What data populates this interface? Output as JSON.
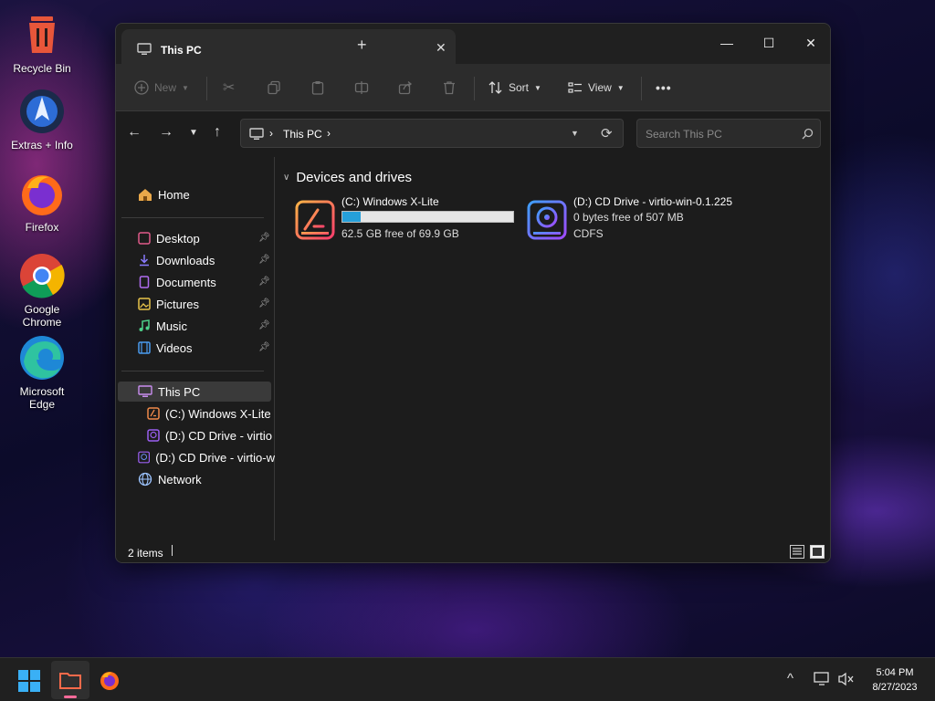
{
  "desktop": {
    "icons": [
      {
        "label": "Recycle Bin",
        "icon": "recycle-bin-icon"
      },
      {
        "label": "Extras + Info",
        "icon": "extras-info-icon"
      },
      {
        "label": "Firefox",
        "icon": "firefox-icon"
      },
      {
        "label": "Google Chrome",
        "icon": "chrome-icon"
      },
      {
        "label": "Microsoft Edge",
        "icon": "edge-icon"
      }
    ]
  },
  "window": {
    "tab_title": "This PC",
    "tab_close": "✕",
    "new_tab": "+",
    "controls": {
      "minimize": "—",
      "maximize": "☐",
      "close": "✕"
    }
  },
  "toolbar": {
    "new_label": "New",
    "sort_label": "Sort",
    "view_label": "View",
    "more_label": "•••"
  },
  "address": {
    "path": "This PC",
    "search_placeholder": "Search This PC"
  },
  "sidebar": {
    "home": "Home",
    "quick": [
      {
        "label": "Desktop",
        "icon": "desktop-icon",
        "color": "#e05a8a"
      },
      {
        "label": "Downloads",
        "icon": "downloads-icon",
        "color": "#8a7bff"
      },
      {
        "label": "Documents",
        "icon": "documents-icon",
        "color": "#b06cf0"
      },
      {
        "label": "Pictures",
        "icon": "pictures-icon",
        "color": "#e8c34a"
      },
      {
        "label": "Music",
        "icon": "music-icon",
        "color": "#4dd08a"
      },
      {
        "label": "Videos",
        "icon": "videos-icon",
        "color": "#4a9cf0"
      }
    ],
    "this_pc": "This PC",
    "c_drive": "(C:) Windows X-Lite",
    "d_drive_sub": "(D:) CD Drive - virtio",
    "d_drive": "(D:) CD Drive - virtio-w",
    "network": "Network"
  },
  "content": {
    "section_title": "Devices and drives",
    "drives": [
      {
        "name": "(C:) Windows X-Lite",
        "free_text": "62.5 GB free of 69.9 GB",
        "used_fraction": 0.106
      },
      {
        "name": "(D:) CD Drive - virtio-win-0.1.225",
        "free_text": "0 bytes free of 507 MB",
        "fs": "CDFS"
      }
    ]
  },
  "status": {
    "items": "2 items"
  },
  "taskbar": {
    "time": "5:04 PM",
    "date": "8/27/2023",
    "tray_chevron": "^"
  },
  "colors": {
    "accent": "#26a0da",
    "window_bg": "#1c1c1c",
    "toolbar_bg": "#2c2c2c"
  }
}
